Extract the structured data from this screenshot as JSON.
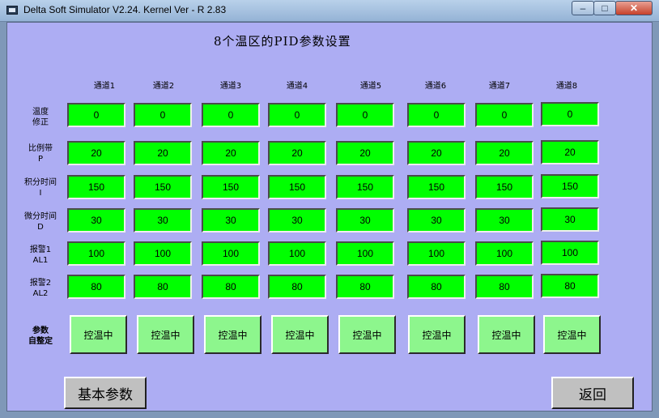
{
  "window": {
    "title": "Delta Soft Simulator V2.24. Kernel Ver - R 2.83",
    "minimize": "–",
    "maximize": "□",
    "close": "✕"
  },
  "page": {
    "title": "8个温区的PID参数设置"
  },
  "columns": [
    "通道1",
    "通道2",
    "通道3",
    "通道4",
    "通道5",
    "通道6",
    "通道7",
    "通道8"
  ],
  "rows": [
    {
      "label": "温度\n修正",
      "values": [
        "0",
        "0",
        "0",
        "0",
        "0",
        "0",
        "0",
        "0"
      ]
    },
    {
      "label": "比例带\nP",
      "values": [
        "20",
        "20",
        "20",
        "20",
        "20",
        "20",
        "20",
        "20"
      ]
    },
    {
      "label": "积分时间\nI",
      "values": [
        "150",
        "150",
        "150",
        "150",
        "150",
        "150",
        "150",
        "150"
      ]
    },
    {
      "label": "微分时间\nD",
      "values": [
        "30",
        "30",
        "30",
        "30",
        "30",
        "30",
        "30",
        "30"
      ]
    },
    {
      "label": "报警1\nAL1",
      "values": [
        "100",
        "100",
        "100",
        "100",
        "100",
        "100",
        "100",
        "100"
      ]
    },
    {
      "label": "报警2\nAL2",
      "values": [
        "80",
        "80",
        "80",
        "80",
        "80",
        "80",
        "80",
        "80"
      ]
    }
  ],
  "autotune": {
    "label": "参数\n自整定",
    "buttons": [
      "控温中",
      "控温中",
      "控温中",
      "控温中",
      "控温中",
      "控温中",
      "控温中",
      "控温中"
    ]
  },
  "footer": {
    "basic_params": "基本参数",
    "back": "返回"
  },
  "colors": {
    "client_bg": "#adadf3",
    "cell_bg": "#00ff00",
    "button_bg": "#8df68d",
    "gray_button": "#c0c0c0"
  }
}
